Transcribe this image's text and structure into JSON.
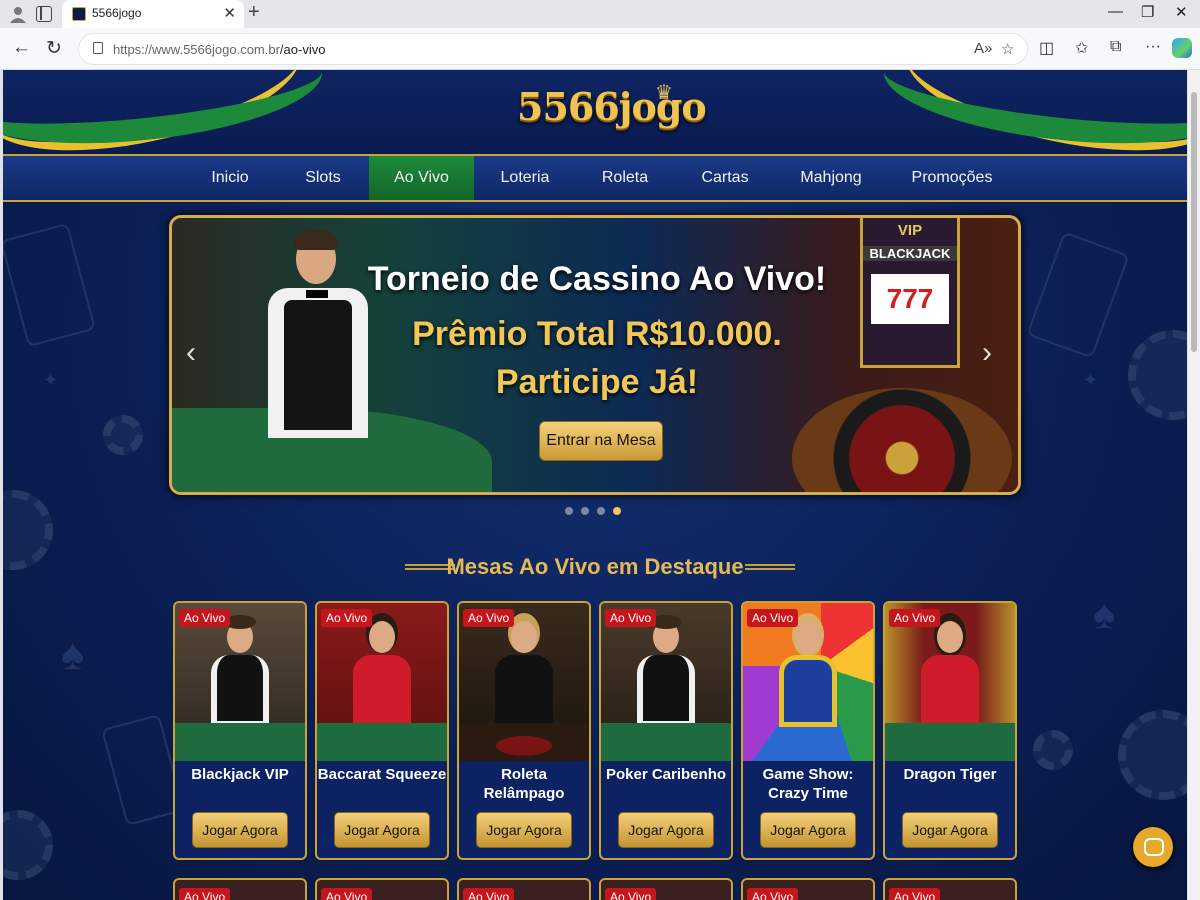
{
  "browser": {
    "tab_title": "5566jogo",
    "url_host": "https://www.5566jogo.com.br",
    "url_path": "/ao-vivo"
  },
  "site": {
    "logo": "5566jogo",
    "nav": [
      {
        "label": "Inicio",
        "active": false
      },
      {
        "label": "Slots",
        "active": false
      },
      {
        "label": "Ao Vivo",
        "active": true
      },
      {
        "label": "Loteria",
        "active": false
      },
      {
        "label": "Roleta",
        "active": false
      },
      {
        "label": "Cartas",
        "active": false
      },
      {
        "label": "Mahjong",
        "active": false
      },
      {
        "label": "Promoções",
        "active": false
      }
    ],
    "hero": {
      "title": "Torneio de Cassino Ao Vivo!",
      "line1": "Prêmio Total R$10.000.",
      "line2": "Participe Já!",
      "button": "Entrar na Mesa",
      "slot_vip": "VIP",
      "slot_label": "BLACKJACK",
      "slot_reels": "777",
      "slides": 4,
      "active_slide": 4
    },
    "section_title": "Mesas Ao Vivo em Destaque",
    "badge": "Ao Vivo",
    "play_label": "Jogar Agora",
    "games": [
      {
        "name": "Blackjack VIP"
      },
      {
        "name": "Baccarat Squeeze"
      },
      {
        "name": "Roleta Relâmpago"
      },
      {
        "name": "Poker Caribenho"
      },
      {
        "name": "Game Show: Crazy Time"
      },
      {
        "name": "Dragon Tiger"
      }
    ]
  },
  "colors": {
    "accent_gold": "#c9a23a",
    "nav_active": "#1f8a3a",
    "badge_red": "#c4161c",
    "background_navy": "#0b1f55"
  }
}
